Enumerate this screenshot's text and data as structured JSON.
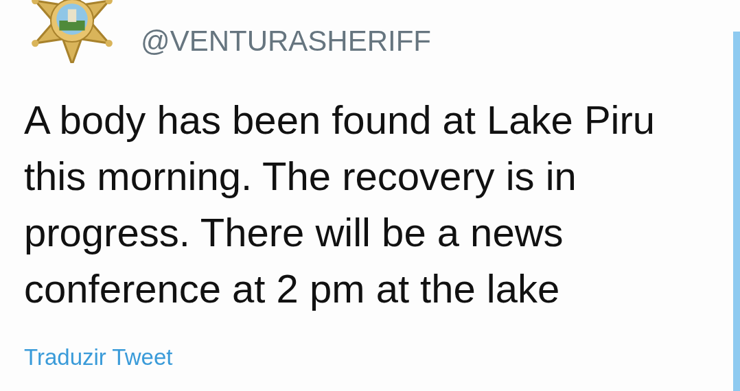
{
  "account": {
    "handle": "@VENTURASHERIFF"
  },
  "tweet": {
    "text": "A body has been found at Lake Piru this morning. The recovery is in progress. There will be a news conference at 2 pm at the lake",
    "translate_link": "Traduzir Tweet"
  }
}
